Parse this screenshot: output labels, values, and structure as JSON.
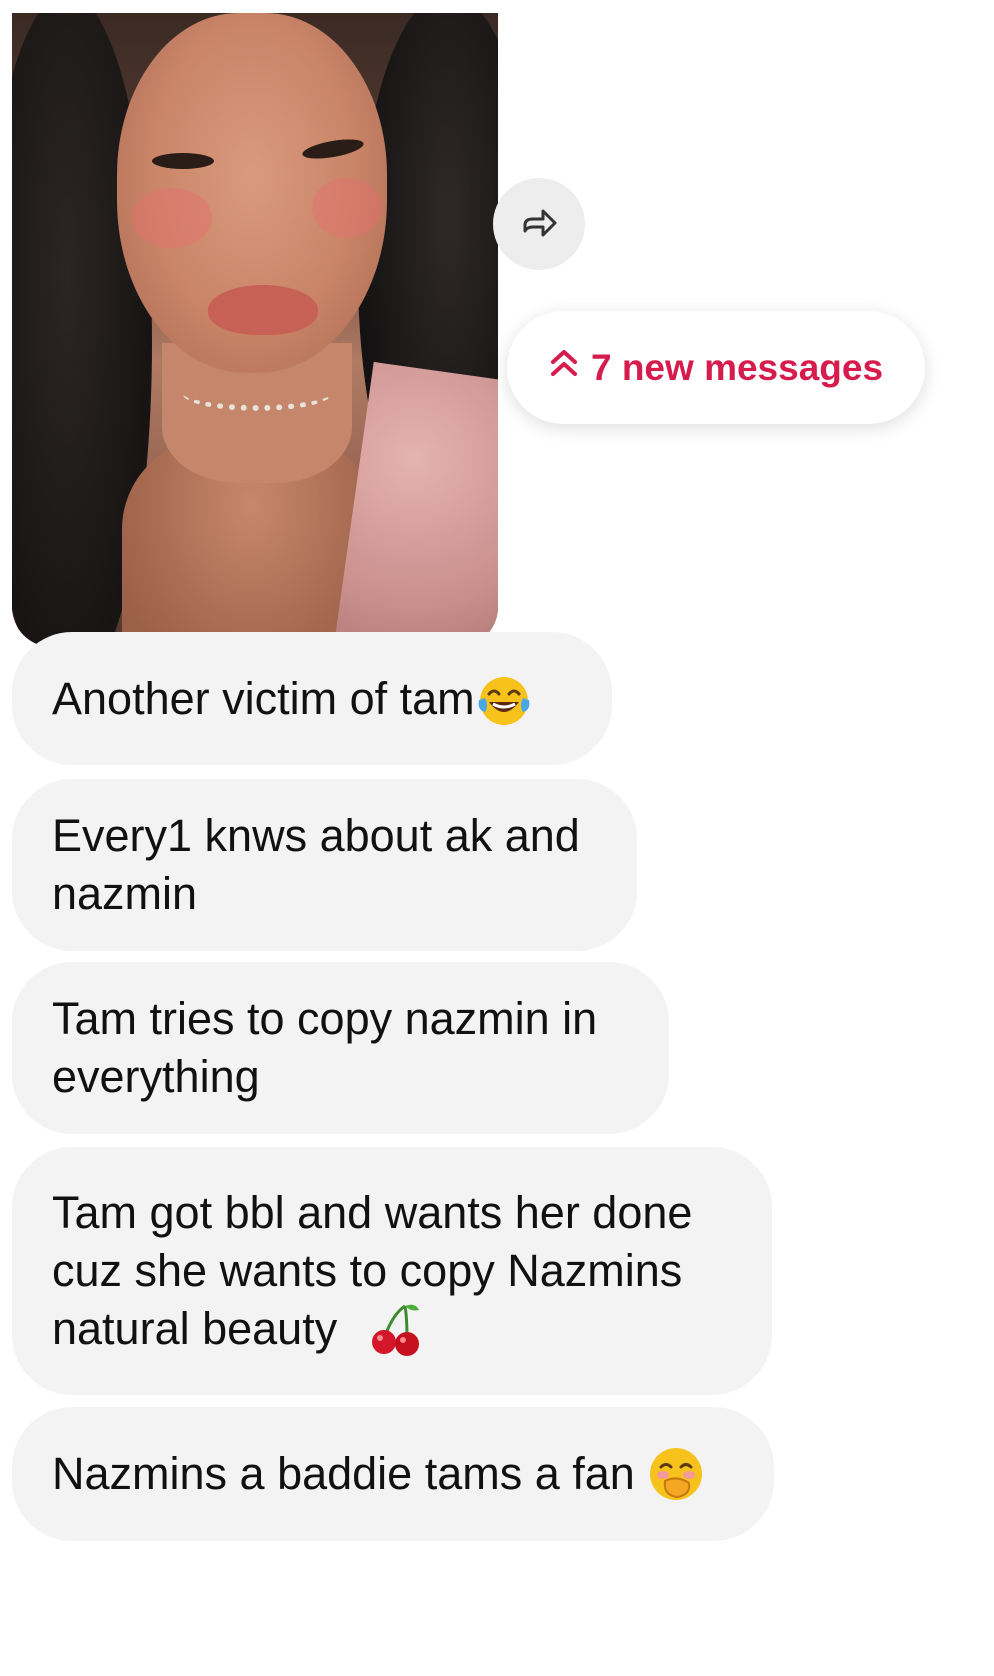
{
  "media": {
    "photo_alt": "selfie photo"
  },
  "actions": {
    "share_icon": "share-forward-icon",
    "new_messages_label": "7 new messages",
    "new_messages_icon": "double-chevron-up-icon",
    "accent_color": "#d61b4d"
  },
  "messages": [
    {
      "text": "Another victim of tam",
      "emoji": "face-with-tears-of-joy"
    },
    {
      "text": "Every1 knws about ak and\nnazmin"
    },
    {
      "text": "Tam tries to copy nazmin in\neverything"
    },
    {
      "text": "Tam got bbl and wants her done\ncuz she wants to copy Nazmins",
      "line3": "natural beauty",
      "emoji": "cherries"
    },
    {
      "text": "Nazmins a baddie tams a fan ",
      "emoji": "face-with-hand-over-mouth"
    }
  ]
}
